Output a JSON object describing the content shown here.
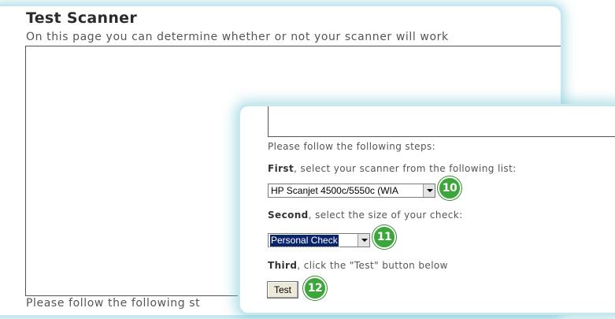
{
  "back_panel": {
    "title": "Test Scanner",
    "intro": "On this page you can determine whether or not your scanner will work",
    "steps_heading": "Please follow the following st"
  },
  "front_panel": {
    "steps_heading": "Please follow the following steps:",
    "step1": {
      "lead": "First",
      "text": ", select your scanner from the following list:",
      "selected": "HP Scanjet 4500c/5550c (WIA",
      "badge": "10"
    },
    "step2": {
      "lead": "Second",
      "text": ", select the size of your check:",
      "selected": "Personal Check",
      "badge": "11"
    },
    "step3": {
      "lead": "Third",
      "text": ", click the \"Test\" button below",
      "button_label": "Test",
      "badge": "12"
    }
  },
  "colors": {
    "badge": "#3da63a",
    "panel_glow": "#c6e8ee",
    "selected_highlight": "#0a246a"
  },
  "icons": [
    "dropdown-arrow-icon"
  ]
}
